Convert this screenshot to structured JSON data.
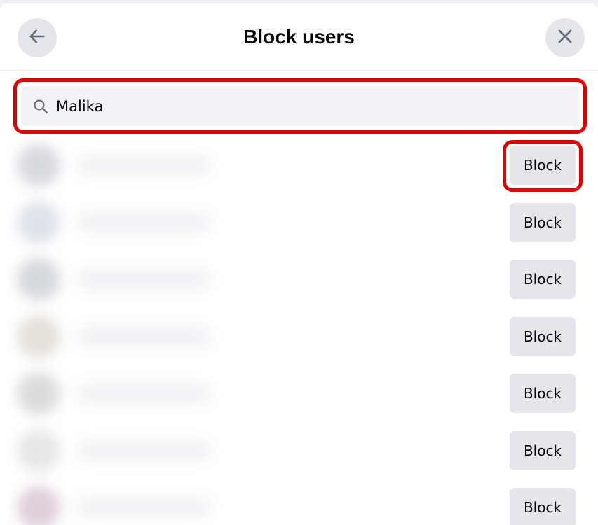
{
  "dialog": {
    "title": "Block users",
    "back_icon": "arrow-left-icon",
    "close_icon": "close-icon"
  },
  "search": {
    "icon": "search-icon",
    "value": "Malika",
    "placeholder": ""
  },
  "results": [
    {
      "button_label": "Block",
      "highlighted": true,
      "avatar_color": "#b8bcc6"
    },
    {
      "button_label": "Block",
      "highlighted": false,
      "avatar_color": "#c6ccd8"
    },
    {
      "button_label": "Block",
      "highlighted": false,
      "avatar_color": "#b5bac2"
    },
    {
      "button_label": "Block",
      "highlighted": false,
      "avatar_color": "#cfc8bd"
    },
    {
      "button_label": "Block",
      "highlighted": false,
      "avatar_color": "#bdbfc3"
    },
    {
      "button_label": "Block",
      "highlighted": false,
      "avatar_color": "#d2d4d8"
    },
    {
      "button_label": "Block",
      "highlighted": false,
      "avatar_color": "#c7a9bd"
    }
  ],
  "colors": {
    "highlight": "#e00000",
    "button_bg": "#e4e6eb",
    "search_bg": "#f0f2f5"
  }
}
